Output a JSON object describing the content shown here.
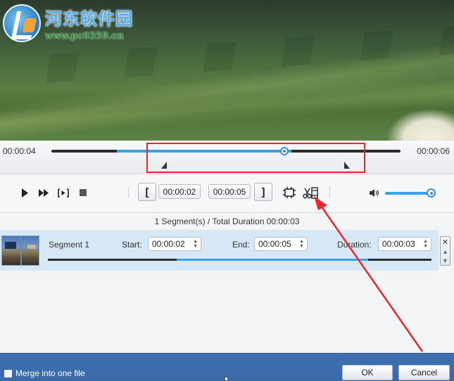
{
  "watermark": {
    "title": "河东软件园",
    "url": "www.pc0359.cn"
  },
  "timeline": {
    "current_time": "00:00:04",
    "total_time": "00:00:06",
    "progress_fraction": 0.67,
    "selection_start_fraction": 0.335,
    "selection_end_fraction": 0.835
  },
  "controls": {
    "play_icon": "play-icon",
    "fast_forward_icon": "fast-forward-icon",
    "frame_step_icon": "frame-step-icon",
    "stop_icon": "stop-icon",
    "set_start_glyph": "[",
    "start_time": "00:00:02",
    "end_time": "00:00:05",
    "set_end_glyph": "]",
    "add_segment_icon": "add-segment-icon",
    "split_icon": "scissors-film-icon",
    "volume_icon": "speaker-icon",
    "volume_fraction": 1.0
  },
  "summary": {
    "text": "1 Segment(s) / Total Duration 00:00:03"
  },
  "segments": [
    {
      "name": "Segment 1",
      "start_label": "Start:",
      "start": "00:00:02",
      "end_label": "End:",
      "end": "00:00:05",
      "duration_label": "Duration:",
      "duration": "00:00:03"
    }
  ],
  "footer": {
    "merge_label": "Merge into one file",
    "merge_checked": false,
    "ok_label": "OK",
    "cancel_label": "Cancel"
  },
  "colors": {
    "accent": "#3aa2e6",
    "highlight": "#e8262d",
    "footer": "#3d6fb0"
  }
}
